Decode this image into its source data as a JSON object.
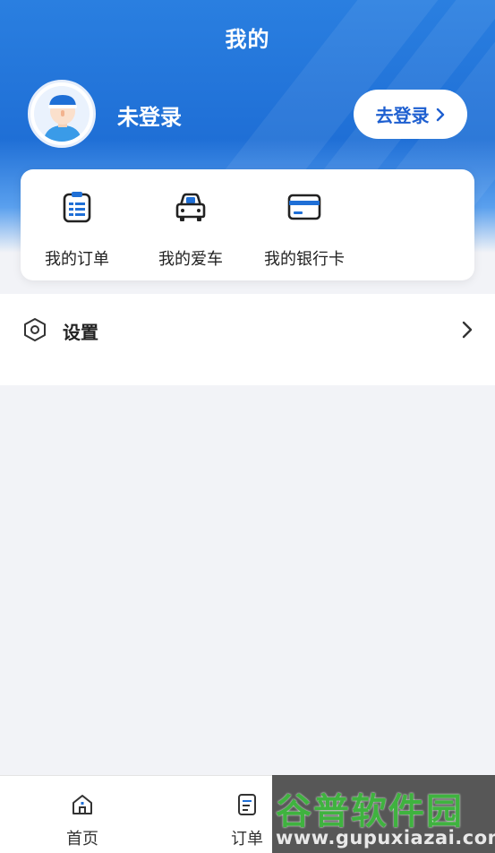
{
  "header": {
    "title": "我的",
    "login_status": "未登录",
    "login_button": "去登录"
  },
  "quick_actions": [
    {
      "label": "我的订单",
      "icon": "order-clipboard-icon"
    },
    {
      "label": "我的爱车",
      "icon": "car-icon"
    },
    {
      "label": "我的银行卡",
      "icon": "bank-card-icon"
    }
  ],
  "settings": {
    "label": "设置",
    "icon": "hexagon-gear-icon"
  },
  "tabbar": {
    "tabs": [
      {
        "label": "首页",
        "icon": "home-icon"
      },
      {
        "label": "订单",
        "icon": "order-icon"
      }
    ]
  },
  "watermark": {
    "brand": "谷普软件园",
    "url": "www.gupuxiazai.com"
  },
  "colors": {
    "primary": "#1f6fd6",
    "accent_text": "#1e5fd0",
    "background": "#f2f3f7"
  }
}
